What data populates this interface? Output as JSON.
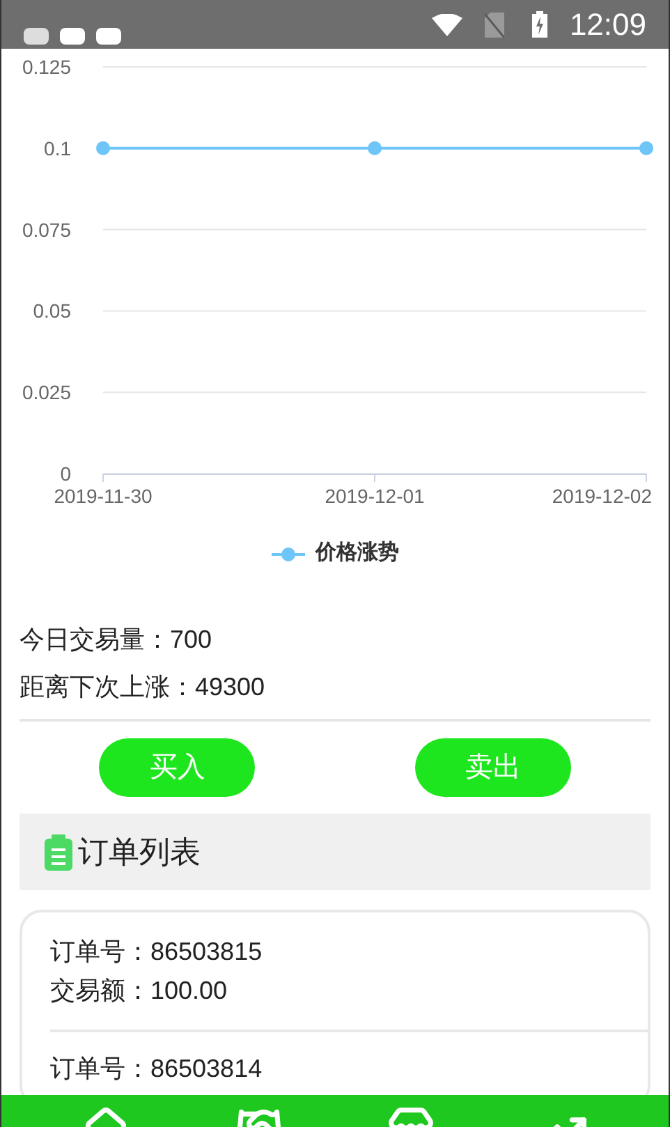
{
  "status_bar": {
    "time": "12:09"
  },
  "chart": {
    "chart_data": {
      "type": "line",
      "categories": [
        "2019-11-30",
        "2019-12-01",
        "2019-12-02"
      ],
      "grid": true,
      "series": [
        {
          "name": "价格涨势",
          "color": "#6ec6f8",
          "marker": true,
          "values": [
            0.1,
            0.1,
            0.1
          ]
        }
      ],
      "ylim": [
        0,
        0.125
      ],
      "yticks": [
        0,
        {
          "value": 0.025,
          "label": "0.025"
        },
        {
          "value": 0.05,
          "label": "0.05"
        },
        {
          "value": 0.075,
          "label": "0.075"
        },
        {
          "value": 0.1,
          "label": "0.1"
        },
        {
          "value": 0.125,
          "label": "0.125"
        }
      ]
    }
  },
  "stats": [
    "今日交易量：700",
    "距离下次上涨：49300"
  ],
  "buttons": [
    "买入",
    "卖出"
  ],
  "order_list": {
    "title": "订单列表",
    "orders": [
      {
        "order_no": "订单号：86503815",
        "amount": "交易额：100.00"
      },
      {
        "order_no": "订单号：86503814"
      }
    ]
  },
  "bottom_nav": [
    {
      "kind": "home"
    },
    {
      "kind": "handshake"
    },
    {
      "kind": "store"
    },
    {
      "kind": "chart"
    }
  ]
}
